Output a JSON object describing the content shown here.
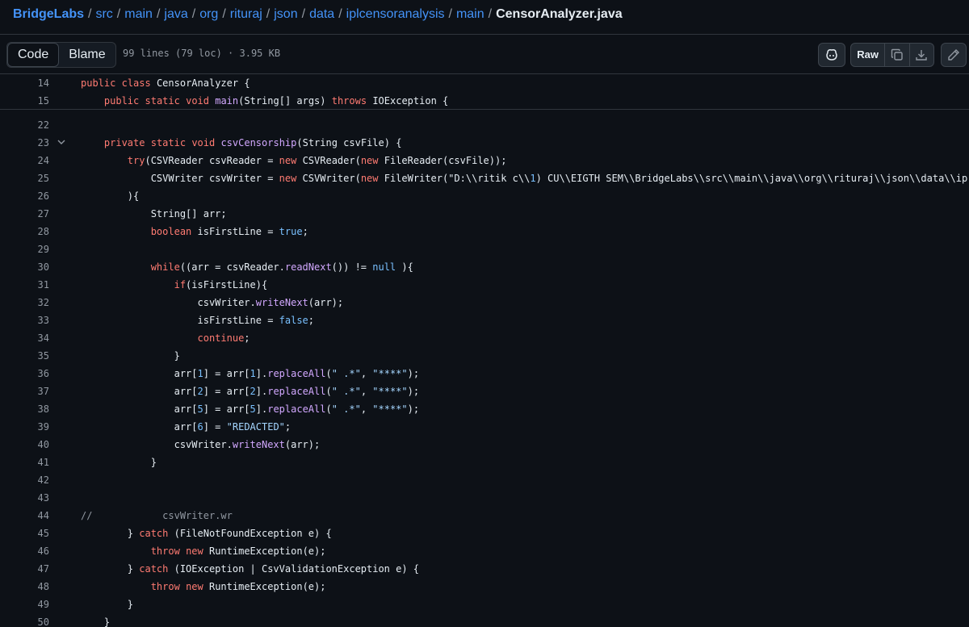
{
  "breadcrumb": {
    "root": "BridgeLabs",
    "segments": [
      "src",
      "main",
      "java",
      "org",
      "rituraj",
      "json",
      "data",
      "iplcensoranalysis",
      "main"
    ],
    "separator": "/",
    "file": "CensorAnalyzer.java"
  },
  "toolbar": {
    "code_tab": "Code",
    "blame_tab": "Blame",
    "file_info": "99 lines (79 loc) · 3.95 KB",
    "raw_label": "Raw"
  },
  "icons": {
    "copilot": "copilot-icon",
    "copy": "copy-icon",
    "download": "download-icon",
    "edit": "pencil-icon",
    "fold": "chevron-down-icon"
  },
  "code": {
    "sticky": [
      {
        "n": "14",
        "text": "public class CensorAnalyzer {"
      },
      {
        "n": "15",
        "text": "    public static void main(String[] args) throws IOException {"
      }
    ],
    "lines": [
      {
        "n": "22",
        "text": ""
      },
      {
        "n": "23",
        "text": "    private static void csvCensorship(String csvFile) {",
        "fold": true
      },
      {
        "n": "24",
        "text": "        try(CSVReader csvReader = new CSVReader(new FileReader(csvFile));"
      },
      {
        "n": "25",
        "text": "            CSVWriter csvWriter = new CSVWriter(new FileWriter(\"D:\\\\ritik c\\\\1) CU\\\\EIGTH SEM\\\\BridgeLabs\\\\src\\\\main\\\\java\\\\org\\\\rituraj\\\\json\\\\data\\\\ip"
      },
      {
        "n": "26",
        "text": "        ){"
      },
      {
        "n": "27",
        "text": "            String[] arr;"
      },
      {
        "n": "28",
        "text": "            boolean isFirstLine = true;"
      },
      {
        "n": "29",
        "text": ""
      },
      {
        "n": "30",
        "text": "            while((arr = csvReader.readNext()) != null ){"
      },
      {
        "n": "31",
        "text": "                if(isFirstLine){"
      },
      {
        "n": "32",
        "text": "                    csvWriter.writeNext(arr);"
      },
      {
        "n": "33",
        "text": "                    isFirstLine = false;"
      },
      {
        "n": "34",
        "text": "                    continue;"
      },
      {
        "n": "35",
        "text": "                }"
      },
      {
        "n": "36",
        "text": "                arr[1] = arr[1].replaceAll(\" .*\", \"****\");"
      },
      {
        "n": "37",
        "text": "                arr[2] = arr[2].replaceAll(\" .*\", \"****\");"
      },
      {
        "n": "38",
        "text": "                arr[5] = arr[5].replaceAll(\" .*\", \"****\");"
      },
      {
        "n": "39",
        "text": "                arr[6] = \"REDACTED\";"
      },
      {
        "n": "40",
        "text": "                csvWriter.writeNext(arr);"
      },
      {
        "n": "41",
        "text": "            }"
      },
      {
        "n": "42",
        "text": ""
      },
      {
        "n": "43",
        "text": ""
      },
      {
        "n": "44",
        "text": "//            csvWriter.wr"
      },
      {
        "n": "45",
        "text": "        } catch (FileNotFoundException e) {"
      },
      {
        "n": "46",
        "text": "            throw new RuntimeException(e);"
      },
      {
        "n": "47",
        "text": "        } catch (IOException | CsvValidationException e) {"
      },
      {
        "n": "48",
        "text": "            throw new RuntimeException(e);"
      },
      {
        "n": "49",
        "text": "        }"
      },
      {
        "n": "50",
        "text": "    }"
      }
    ]
  }
}
